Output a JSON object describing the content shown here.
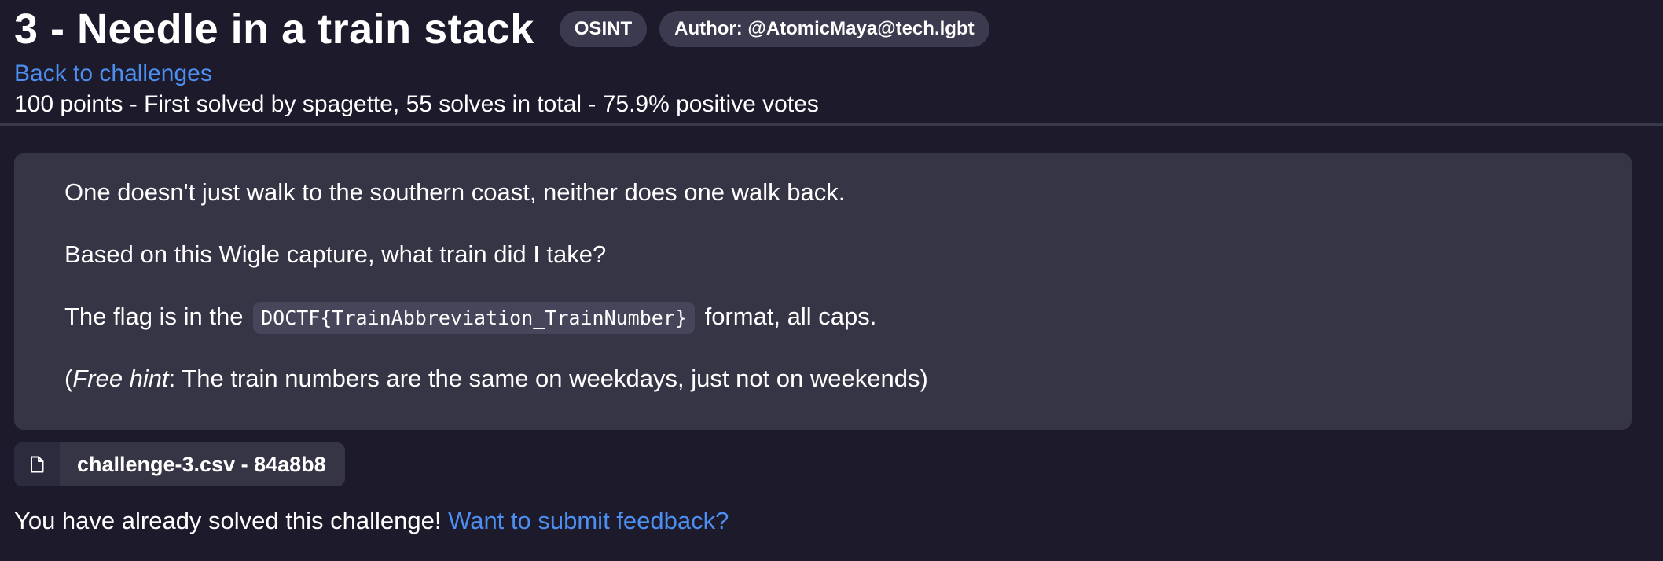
{
  "challenge": {
    "title": "3 - Needle in a train stack",
    "category": "OSINT",
    "author": "Author: @AtomicMaya@tech.lgbt",
    "back_link": "Back to challenges",
    "meta": "100 points - First solved by spagette, 55 solves in total - 75.9% positive votes"
  },
  "description": {
    "line1": "One doesn't just walk to the southern coast, neither does one walk back.",
    "line2": "Based on this Wigle capture, what train did I take?",
    "line3_before": "The flag is in the",
    "line3_code": "DOCTF{TrainAbbreviation_TrainNumber}",
    "line3_after": "format, all caps.",
    "line4_open": "(",
    "line4_em": "Free hint",
    "line4_rest": ": The train numbers are the same on weekdays, just not on weekends)"
  },
  "attachment": {
    "icon": "file-icon",
    "label": "challenge-3.csv - 84a8b8"
  },
  "status": {
    "message": "You have already solved this challenge!",
    "feedback_link": "Want to submit feedback?"
  },
  "colors": {
    "background": "#1c1a2b",
    "panel": "#363545",
    "badge": "#3b3a4e",
    "link": "#4d8ff0"
  }
}
